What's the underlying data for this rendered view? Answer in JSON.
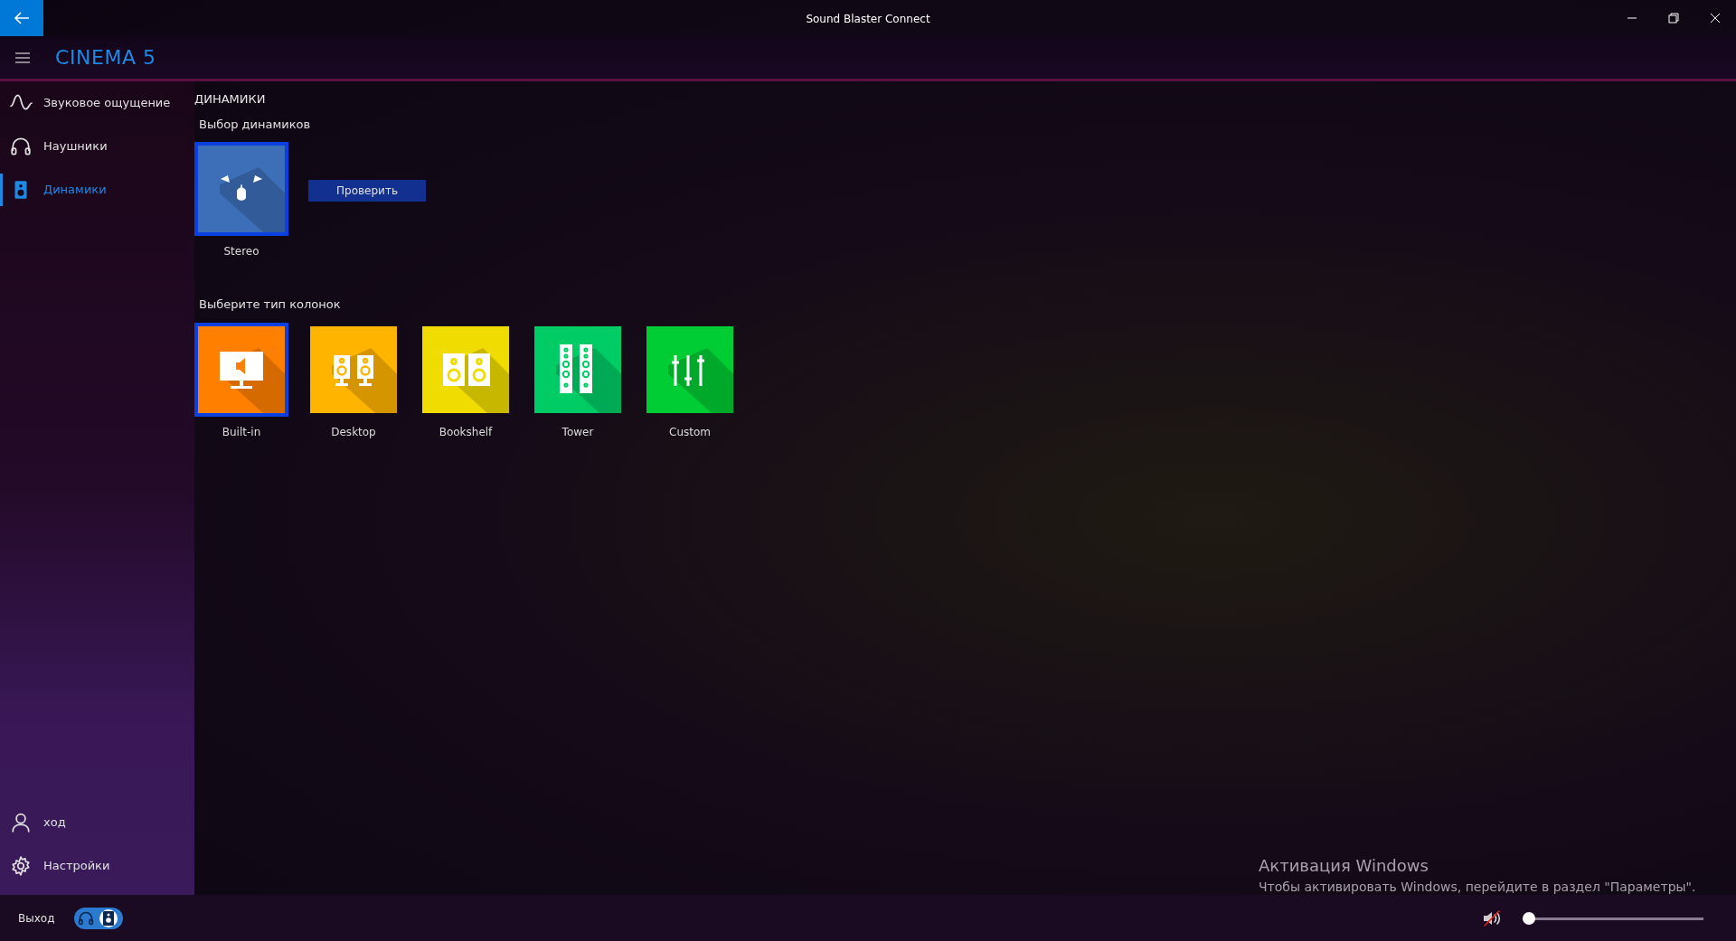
{
  "window": {
    "title": "Sound Blaster Connect"
  },
  "header": {
    "device": "CINEMA 5"
  },
  "sidebar": {
    "items": [
      {
        "label": "Звуковое ощущение",
        "kind": "wave",
        "selected": false
      },
      {
        "label": "Наушники",
        "kind": "headphones",
        "selected": false
      },
      {
        "label": "Динамики",
        "kind": "speaker",
        "selected": true
      }
    ],
    "bottom_items": [
      {
        "label": "ход",
        "kind": "user"
      },
      {
        "label": "Настройки",
        "kind": "gear"
      }
    ]
  },
  "page": {
    "title": "ДИНАМИКИ",
    "speaker_selection": {
      "label": "Выбор динамиков",
      "options": [
        {
          "label": "Stereo",
          "selected": true
        }
      ],
      "test_button": "Проверить"
    },
    "speaker_type": {
      "label": "Выберите тип колонок",
      "options": [
        {
          "label": "Built-in",
          "kind": "builtin",
          "color": "#ff8000",
          "selected": true
        },
        {
          "label": "Desktop",
          "kind": "desktop",
          "color": "#ffb400",
          "selected": false
        },
        {
          "label": "Bookshelf",
          "kind": "bookshelf",
          "color": "#f0dc00",
          "selected": false
        },
        {
          "label": "Tower",
          "kind": "tower",
          "color": "#00cc66",
          "selected": false
        },
        {
          "label": "Custom",
          "kind": "custom",
          "color": "#00cc33",
          "selected": false
        }
      ]
    }
  },
  "footer": {
    "exit_label": "Выход",
    "speakers_selected": true,
    "volume": {
      "muted": true,
      "level": 0
    }
  },
  "activation_notice": {
    "title": "Активация Windows",
    "text": "Чтобы активировать Windows, перейдите в раздел \"Параметры\"."
  }
}
